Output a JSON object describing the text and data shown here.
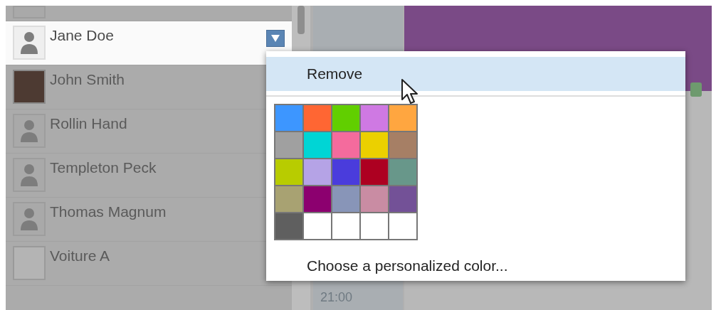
{
  "contacts": [
    {
      "name": "Jane Doe",
      "kind": "silhouette",
      "selected": true
    },
    {
      "name": "John Smith",
      "kind": "photo",
      "selected": false
    },
    {
      "name": "Rollin Hand",
      "kind": "silhouette",
      "selected": false
    },
    {
      "name": "Templeton Peck",
      "kind": "silhouette",
      "selected": false
    },
    {
      "name": "Thomas Magnum",
      "kind": "silhouette",
      "selected": false
    },
    {
      "name": "Voiture A",
      "kind": "blank",
      "selected": false
    }
  ],
  "calendar": {
    "time_label": "21:00"
  },
  "menu": {
    "items": [
      {
        "label": "Remove",
        "selected": true
      }
    ],
    "swatches": [
      {
        "color": "#3d96ff"
      },
      {
        "color": "#ff6633"
      },
      {
        "color": "#61cf00"
      },
      {
        "color": "#cf79e3"
      },
      {
        "color": "#ffa640"
      },
      {
        "color": "#a0a0a0"
      },
      {
        "color": "#00d5d5"
      },
      {
        "color": "#f46b9d"
      },
      {
        "color": "#ebd000"
      },
      {
        "color": "#a67f65"
      },
      {
        "color": "#b8cc00"
      },
      {
        "color": "#b5a3e6"
      },
      {
        "color": "#4a3cdc"
      },
      {
        "color": "#ad0021"
      },
      {
        "color": "#68978a"
      },
      {
        "color": "#a8a272"
      },
      {
        "color": "#8c006f"
      },
      {
        "color": "#8895b8"
      },
      {
        "color": "#c98ca3"
      },
      {
        "color": "#735197"
      },
      {
        "color": "#5f5f5f"
      },
      {
        "color": "#ffffff"
      },
      {
        "color": "#ffffff"
      },
      {
        "color": "#ffffff"
      },
      {
        "color": "#ffffff"
      }
    ],
    "custom_color_label": "Choose a personalized color..."
  }
}
